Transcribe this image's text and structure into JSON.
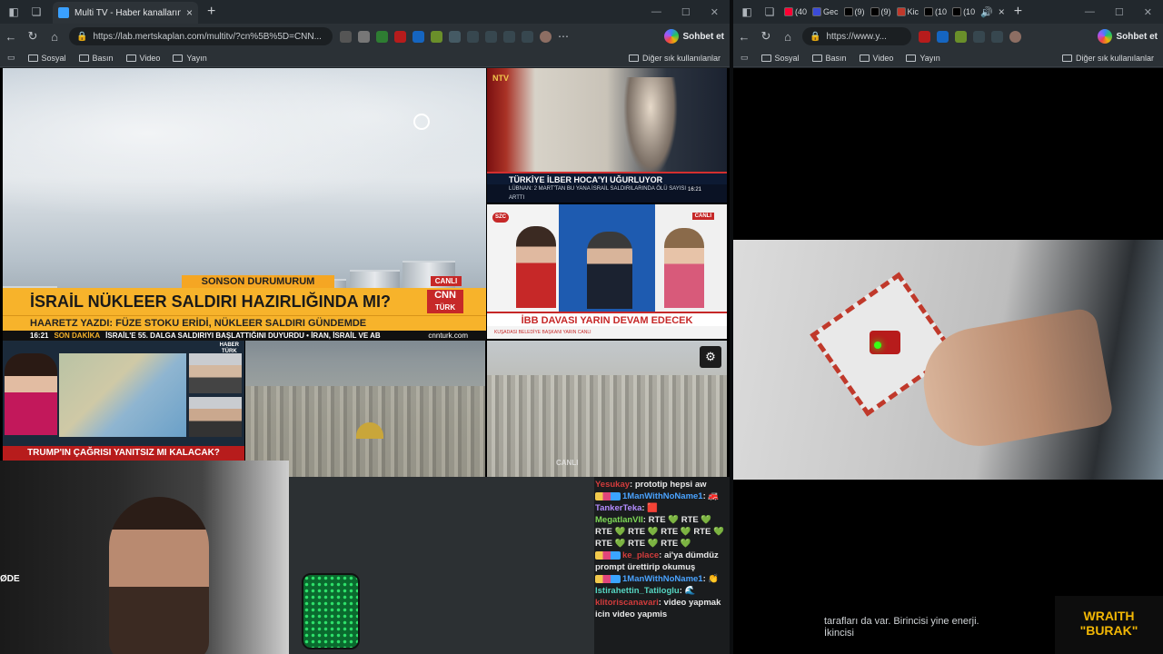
{
  "left_window": {
    "tab_title": "Multi TV - Haber kanallarını aynı a",
    "url": "https://lab.mertskaplan.com/multitv/?cn%5B%5D=CNN...",
    "copilot_label": "Sohbet et",
    "bookmarks": [
      "Sosyal",
      "Basın",
      "Video",
      "Yayın"
    ],
    "other_bookmarks": "Diğer sık kullanılanlar"
  },
  "right_window": {
    "tabs": [
      {
        "label": "(40",
        "color": "#ff0033"
      },
      {
        "label": "Gec",
        "color": "#3b4bd8"
      },
      {
        "label": "(9)",
        "color": "#000000"
      },
      {
        "label": "(9)",
        "color": "#000000"
      },
      {
        "label": "Kic",
        "color": "#c0392b"
      },
      {
        "label": "(10",
        "color": "#000000"
      },
      {
        "label": "(10",
        "color": "#000000"
      }
    ],
    "url": "https://www.y...",
    "copilot_label": "Sohbet et",
    "bookmarks": [
      "Sosyal",
      "Basın",
      "Video",
      "Yayın"
    ],
    "other_bookmarks": "Diğer sık kullanılanlar",
    "subtitle_line1": "tarafları da var. Birincisi yine enerji.",
    "subtitle_line2": "İkincisi",
    "watermark_top": "WRAITH",
    "watermark_bottom": "\"BURAK\""
  },
  "streams": {
    "cnn": {
      "top_banner": "SONSON DURUMURUM",
      "headline": "İSRAİL NÜKLEER SALDIRI HAZIRLIĞINDA MI?",
      "subhead": "HAARETZ YAZDI: FÜZE STOKU ERİDİ, NÜKLEER SALDIRI GÜNDEMDE",
      "time": "16:21",
      "ticker_tag": "SON DAKİKA",
      "ticker": "İSRAİL'E 55. DALGA SALDIRIYI BAŞLATTIĞINI DUYURDU  •  İRAN, İSRAİL VE AB",
      "site": "cnnturk.com",
      "canli": "CANLI",
      "logo_top": "CNN",
      "logo_bottom": "TÜRK"
    },
    "ntv": {
      "logo": "NTV",
      "headline": "TÜRKİYE İLBER HOCA'YI UĞURLUYOR",
      "ticker": "LÜBNAN: 2 MART'TAN BU YANA İSRAİL SALDIRILARINDA ÖLÜ SAYISI ARTTI",
      "time": "16:21"
    },
    "szc": {
      "logo": "SZC",
      "canli": "CANLI",
      "headline": "İBB DAVASI YARIN DEVAM EDECEK",
      "ticker": "KUŞADASI BELEDİYE BAŞKANI YARIN CANLI"
    },
    "haberturk": {
      "logo_top": "HABER",
      "logo_bottom": "TÜRK",
      "headline": "TRUMP'IN ÇAĞRISI YANITSIZ MI KALACAK?"
    },
    "live_cam": {
      "canli": "CANLI"
    }
  },
  "webcam": {
    "label": "ØDE"
  },
  "chat": [
    {
      "user": "Yesukay",
      "text": "prototip hepsi aw",
      "color": "red",
      "badges": false
    },
    {
      "user": "1ManWithNoName1",
      "text": "🚒",
      "color": "blue",
      "badges": true
    },
    {
      "user": "TankerTeka",
      "text": "🟥",
      "color": "purple",
      "badges": false
    },
    {
      "user": "MegatlanVII",
      "text": "RTE 💚 RTE 💚 RTE 💚 RTE 💚 RTE 💚 RTE 💚 RTE 💚 RTE 💚 RTE 💚",
      "color": "green",
      "badges": false
    },
    {
      "user": "ke_place",
      "text": "ai'ya dümdüz prompt ürettirip okumuş",
      "color": "red",
      "badges": true
    },
    {
      "user": "1ManWithNoName1",
      "text": "👏",
      "color": "blue",
      "badges": true
    },
    {
      "user": "Istirahettin_Tatiloglu",
      "text": "🌊",
      "color": "teal",
      "badges": false
    },
    {
      "user": "klitoriscanavari",
      "text": "video yapmak icin video yapmis",
      "color": "red",
      "badges": false
    }
  ]
}
